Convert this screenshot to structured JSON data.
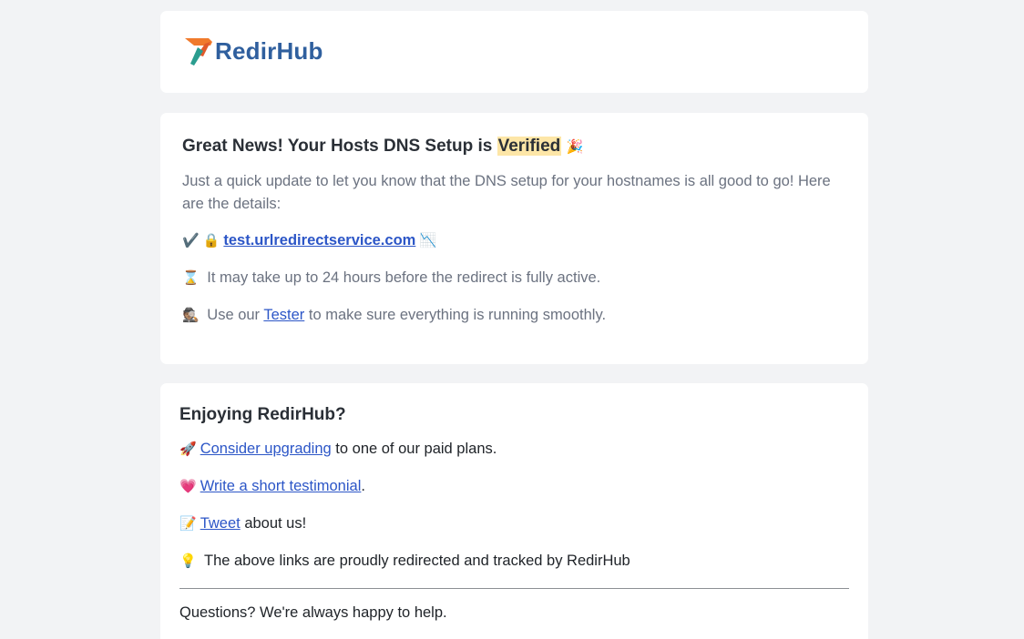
{
  "brand": {
    "name": "RedirHub",
    "colors": {
      "brand_text": "#2f5f9e",
      "mark_orange": "#f07a2c",
      "mark_teal": "#2a9d8f",
      "link": "#2c56c7",
      "highlight": "#fde6a7"
    }
  },
  "main": {
    "heading_prefix": "Great News! Your Hosts DNS Setup is",
    "heading_highlight": "Verified",
    "heading_emoji": "🎉",
    "intro": "Just a quick update to let you know that the DNS setup for your hostnames is all good to go! Here are the details:",
    "host": {
      "check_emoji": "✔️",
      "lock_emoji": "🔒",
      "hostname": "test.urlredirectservice.com",
      "chart_emoji": "📉"
    },
    "wait": {
      "emoji": "⌛",
      "text": "It may take up to 24 hours before the redirect is fully active."
    },
    "tester": {
      "emoji": "🕵🏽",
      "pre": "Use our",
      "link": "Tester",
      "post": "to make sure everything is running smoothly."
    }
  },
  "enjoy": {
    "heading": "Enjoying RedirHub?",
    "upgrade": {
      "emoji": "🚀",
      "link": "Consider upgrading",
      "post": "to one of our paid plans."
    },
    "testimonial": {
      "emoji": "💗",
      "link": "Write a short testimonial",
      "post": "."
    },
    "tweet": {
      "emoji": "📝",
      "link": "Tweet",
      "post": "about us!"
    },
    "tracked": {
      "emoji": "💡",
      "text": "The above links are proudly redirected and tracked by RedirHub"
    },
    "questions": "Questions? We're always happy to help."
  }
}
